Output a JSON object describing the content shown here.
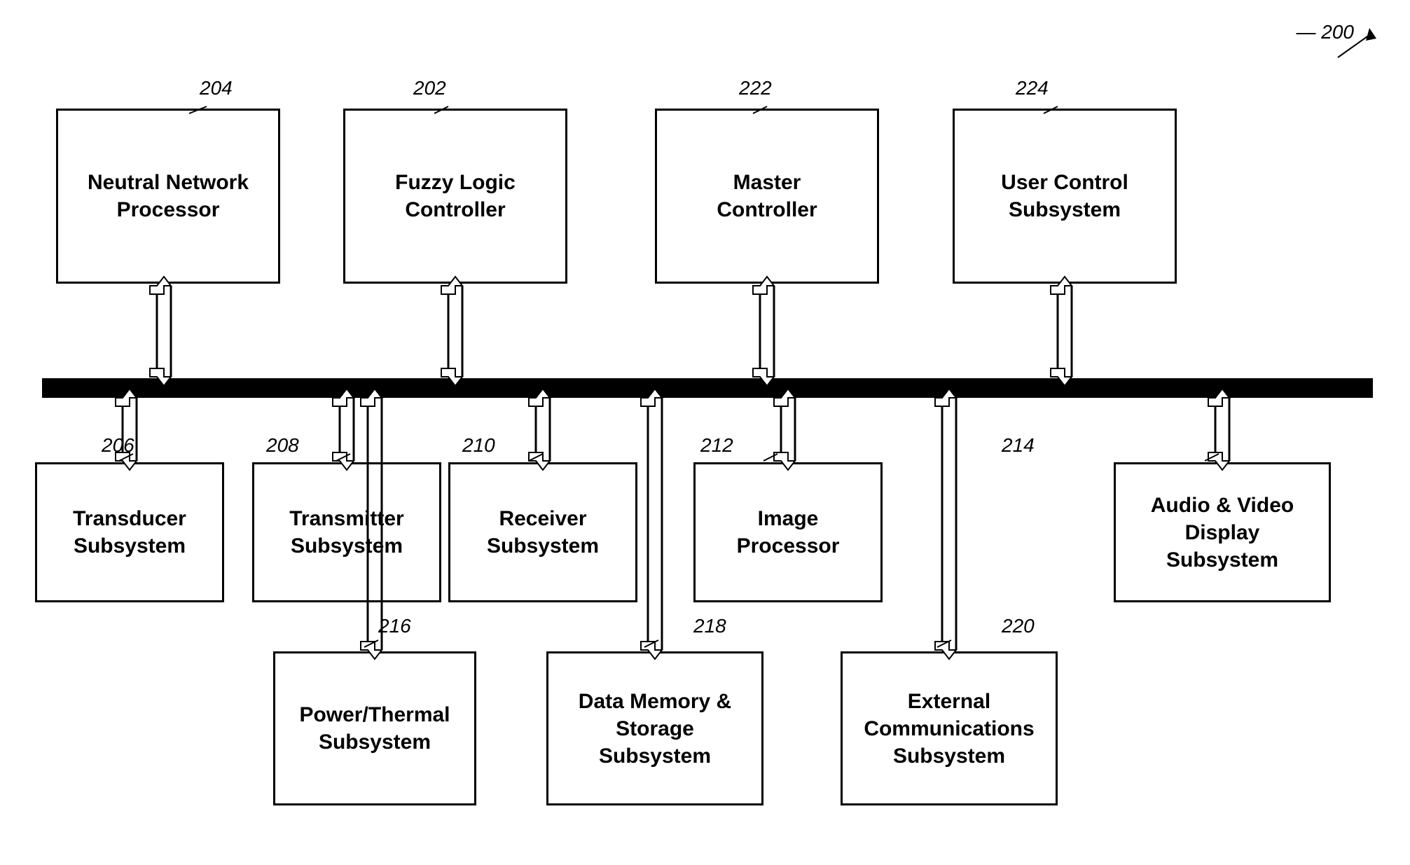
{
  "diagram": {
    "title": "200",
    "components": {
      "top_row": [
        {
          "id": "204",
          "label": "Neutral\nNetwork\nProcessor",
          "ref": "204"
        },
        {
          "id": "202",
          "label": "Fuzzy Logic\nController",
          "ref": "202"
        },
        {
          "id": "222",
          "label": "Master\nController",
          "ref": "222"
        },
        {
          "id": "224",
          "label": "User Control\nSubsystem",
          "ref": "224"
        }
      ],
      "bottom_left": [
        {
          "id": "206",
          "label": "Transducer\nSubsystem",
          "ref": "206"
        },
        {
          "id": "208",
          "label": "Transmitter\nSubsystem",
          "ref": "208"
        },
        {
          "id": "210",
          "label": "Receiver\nSubsystem",
          "ref": "210"
        },
        {
          "id": "212",
          "label": "Image\nProcessor",
          "ref": "212"
        },
        {
          "id": "214",
          "label": "Audio & Video\nDisplay\nSubsystem",
          "ref": "214"
        }
      ],
      "bottom_row": [
        {
          "id": "216",
          "label": "Power/Thermal\nSubsystem",
          "ref": "216"
        },
        {
          "id": "218",
          "label": "Data Memory &\nStorage\nSubsystem",
          "ref": "218"
        },
        {
          "id": "220",
          "label": "External\nCommunications\nSubsystem",
          "ref": "220"
        }
      ]
    }
  }
}
